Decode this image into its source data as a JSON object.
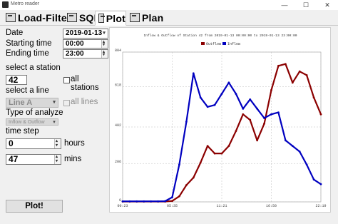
{
  "window": {
    "title": "Metro reader",
    "min": "—",
    "max": "☐",
    "close": "✕"
  },
  "tabs": [
    {
      "label": "Load-Filter"
    },
    {
      "label": "SQL"
    },
    {
      "label": "Plot"
    },
    {
      "label": "Plan"
    }
  ],
  "form": {
    "date_label": "Date",
    "date_value": "2019-01-13",
    "start_label": "Starting time",
    "start_value": "00:00",
    "end_label": "Ending time",
    "end_value": "23:00",
    "station_label": "select a station",
    "station_value": "42",
    "all_stations_label": "all stations",
    "line_label": "select a line",
    "line_value": "Line A",
    "all_lines_label": "all lines",
    "analyze_label": "Type of analyze",
    "analyze_value": "Inflow & Outflow",
    "timestep_label": "time step",
    "hours_value": "0",
    "hours_label": "hours",
    "mins_value": "47",
    "mins_label": "mins",
    "plot_button": "Plot!"
  },
  "colors": {
    "outflow": "#8b0000",
    "inflow": "#0000c0"
  },
  "chart_data": {
    "type": "line",
    "title": "Inflow & Outflow of Station 42 from 2019-01-13 00:00:00 to 2019-01-13 23:00:00",
    "xlabel": "",
    "ylabel": "",
    "x_ticks": [
      "00:23",
      "05:35",
      "11:21",
      "16:50",
      "22:19"
    ],
    "y_ticks": [
      0,
      206,
      402,
      618,
      804
    ],
    "ylim": [
      0,
      804
    ],
    "legend_position": "top-center",
    "x": [
      "00:23",
      "01:10",
      "01:57",
      "02:44",
      "03:31",
      "04:18",
      "05:05",
      "05:52",
      "06:39",
      "07:26",
      "08:13",
      "09:00",
      "09:47",
      "10:34",
      "11:21",
      "12:08",
      "12:55",
      "13:42",
      "14:29",
      "15:16",
      "16:03",
      "16:50",
      "17:37",
      "18:24",
      "19:11",
      "19:58",
      "20:45",
      "21:32",
      "22:19"
    ],
    "series": [
      {
        "name": "Outflow",
        "values": [
          2,
          2,
          2,
          2,
          2,
          2,
          2,
          5,
          30,
          90,
          130,
          210,
          300,
          260,
          260,
          300,
          380,
          470,
          440,
          330,
          420,
          600,
          730,
          740,
          640,
          700,
          680,
          560,
          470
        ]
      },
      {
        "name": "Inflow",
        "values": [
          3,
          3,
          3,
          3,
          3,
          3,
          4,
          25,
          200,
          430,
          690,
          560,
          510,
          520,
          580,
          640,
          580,
          500,
          550,
          500,
          450,
          470,
          480,
          330,
          300,
          270,
          200,
          120,
          95
        ]
      }
    ]
  }
}
